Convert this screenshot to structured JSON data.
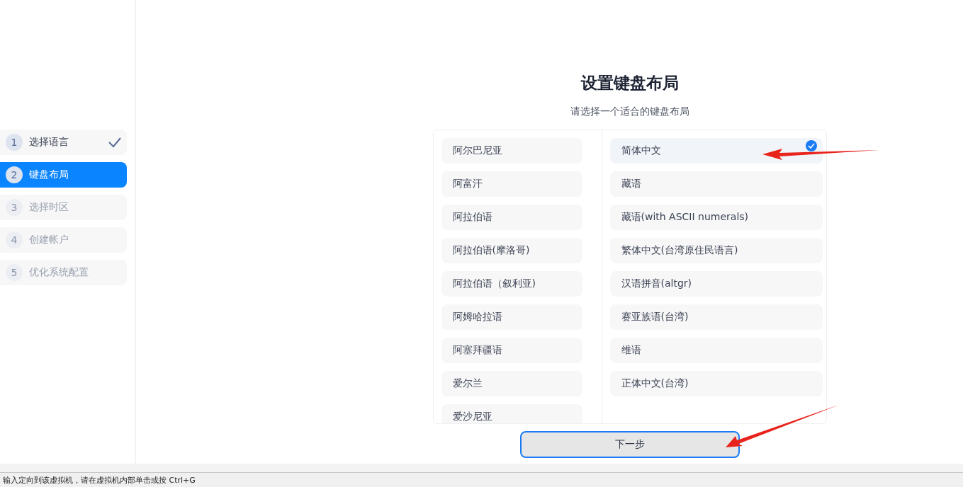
{
  "steps": [
    {
      "number": "1",
      "label": "选择语言",
      "checked": true,
      "selected": false,
      "disabled": false
    },
    {
      "number": "2",
      "label": "键盘布局",
      "checked": false,
      "selected": true,
      "disabled": false
    },
    {
      "number": "3",
      "label": "选择时区",
      "checked": false,
      "selected": false,
      "disabled": true
    },
    {
      "number": "4",
      "label": "创建帐户",
      "checked": false,
      "selected": false,
      "disabled": true
    },
    {
      "number": "5",
      "label": "优化系统配置",
      "checked": false,
      "selected": false,
      "disabled": true
    }
  ],
  "title": "设置键盘布局",
  "subtitle": "请选择一个适合的键盘布局",
  "layouts": [
    {
      "label": "阿尔巴尼亚",
      "selected": false
    },
    {
      "label": "阿富汗",
      "selected": false
    },
    {
      "label": "阿拉伯语",
      "selected": false
    },
    {
      "label": "阿拉伯语(摩洛哥)",
      "selected": false
    },
    {
      "label": "阿拉伯语（叙利亚)",
      "selected": false
    },
    {
      "label": "阿姆哈拉语",
      "selected": false
    },
    {
      "label": "阿塞拜疆语",
      "selected": false
    },
    {
      "label": "爱尔兰",
      "selected": false
    },
    {
      "label": "爱沙尼亚",
      "selected": false
    }
  ],
  "variants": [
    {
      "label": "简体中文",
      "selected": true
    },
    {
      "label": "藏语",
      "selected": false
    },
    {
      "label": "藏语(with ASCII numerals)",
      "selected": false
    },
    {
      "label": "繁体中文(台湾原住民语言)",
      "selected": false
    },
    {
      "label": "汉语拼音(altgr)",
      "selected": false
    },
    {
      "label": "赛亚族语(台湾)",
      "selected": false
    },
    {
      "label": "维语",
      "selected": false
    },
    {
      "label": "正体中文(台湾)",
      "selected": false
    }
  ],
  "next_button": "下一步",
  "status_bar": "输入定向到该虚拟机，请在虚拟机内部单击或按 Ctrl+G"
}
